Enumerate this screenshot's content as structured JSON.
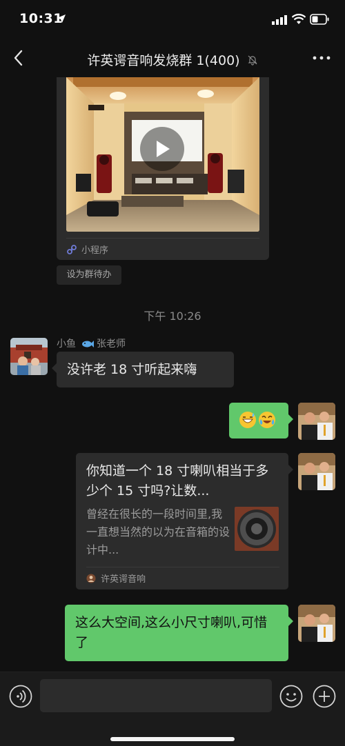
{
  "status_bar": {
    "time": "10:31",
    "icons": [
      "location-arrow-icon",
      "signal-icon",
      "wifi-icon",
      "battery-icon"
    ]
  },
  "nav": {
    "title": "许英谔音响发烧群 1(400)",
    "muted_icon": "bell-slash-icon",
    "more_icon": "more-icon",
    "back_icon": "back-chevron-icon"
  },
  "messages": {
    "mini_program": {
      "label": "小程序",
      "icon": "link-icon",
      "play_icon": "play-icon"
    },
    "todo_button": "设为群待办",
    "time_separator": "下午 10:26",
    "incoming": {
      "sender": "小鱼",
      "sender_role": "张老师",
      "fish_icon": "fish-icon",
      "text": "没许老 18 寸听起来嗨"
    },
    "outgoing_emoji": {
      "emojis": [
        "grinning-sweat-emoji",
        "crying-laughing-emoji"
      ]
    },
    "link_card": {
      "title": "你知道一个 18 寸喇叭相当于多少个 15 寸吗?让数...",
      "description": "曾经在很长的一段时间里,我一直想当然的以为在音箱的设计中...",
      "source": "许英谔音响",
      "thumb_icon": "speaker-driver-icon"
    },
    "outgoing_text": {
      "text": "这么大空间,这么小尺寸喇叭,可惜了"
    }
  },
  "input_bar": {
    "voice_icon": "voice-icon",
    "placeholder": "",
    "emoji_icon": "smiley-icon",
    "plus_icon": "plus-icon"
  },
  "colors": {
    "background": "#111111",
    "bubble_incoming": "#2c2c2c",
    "bubble_outgoing": "#61c86b"
  }
}
